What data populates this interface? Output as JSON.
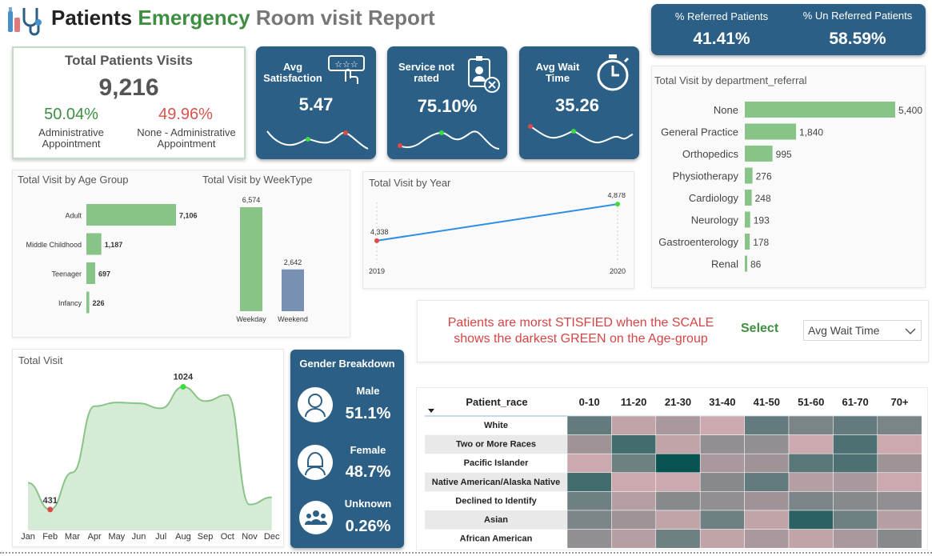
{
  "header": {
    "title_word1": "Patients",
    "title_word2": "Emergency",
    "title_word3": "Room visit Report",
    "logo_icon": "stethoscope-icon"
  },
  "referral_kpi": {
    "referred_label": "% Referred Patients",
    "referred_value": "41.41%",
    "unreferred_label": "% Un Referred Patients",
    "unreferred_value": "58.59%"
  },
  "total_visits_card": {
    "title": "Total Patients Visits",
    "value": "9,216",
    "admin_pct": "50.04%",
    "admin_label": "Administrative Appointment",
    "non_admin_pct": "49.96%",
    "non_admin_label": "None - Administrative Appointment",
    "colors": {
      "admin": "#3e8e41",
      "non_admin": "#d9534f"
    }
  },
  "kpis": [
    {
      "label": "Avg Satisfaction",
      "value": "5.47",
      "icon": "rating-stars-icon"
    },
    {
      "label": "Service not rated",
      "value": "75.10%",
      "icon": "id-badge-x-icon"
    },
    {
      "label": "Avg Wait Time",
      "value": "35.26",
      "icon": "stopwatch-icon"
    }
  ],
  "department_referral": {
    "title": "Total Visit by department_referral",
    "chart_data": {
      "type": "bar",
      "orientation": "horizontal",
      "categories": [
        "None",
        "General Practice",
        "Orthopedics",
        "Physiotherapy",
        "Cardiology",
        "Neurology",
        "Gastroenterology",
        "Renal"
      ],
      "values": [
        5400,
        1840,
        995,
        276,
        248,
        193,
        178,
        86
      ],
      "labels": [
        "5,400",
        "1,840",
        "995",
        "276",
        "248",
        "193",
        "178",
        "86"
      ],
      "color": "#88c488"
    }
  },
  "age_group": {
    "title": "Total Visit by Age Group",
    "chart_data": {
      "type": "bar",
      "orientation": "horizontal",
      "categories": [
        "Adult",
        "Middle Childhood",
        "Teenager",
        "Infancy"
      ],
      "values": [
        7106,
        1187,
        697,
        226
      ],
      "labels": [
        "7,106",
        "1,187",
        "697",
        "226"
      ],
      "color": "#88c488"
    }
  },
  "week_type": {
    "title": "Total Visit by WeekType",
    "chart_data": {
      "type": "bar",
      "categories": [
        "Weekday",
        "Weekend"
      ],
      "values": [
        6574,
        2642
      ],
      "labels": [
        "6,574",
        "2,642"
      ],
      "colors": [
        "#88c488",
        "#7891b3"
      ]
    }
  },
  "by_year": {
    "title": "Total Visit by Year",
    "chart_data": {
      "type": "line",
      "x": [
        "2019",
        "2020"
      ],
      "values": [
        4338,
        4878
      ],
      "labels": [
        "4,338",
        "4,878"
      ],
      "color": "#2f8de4"
    }
  },
  "insight": {
    "message_line1": "Patients are morst STISFIED when the SCALE",
    "message_line2": "shows the darkest GREEN on the Age-group",
    "select_label": "Select",
    "dropdown_value": "Avg Wait Time"
  },
  "total_visit": {
    "title": "Total Visit",
    "chart_data": {
      "type": "area",
      "x": [
        "Jan",
        "Feb",
        "Mar",
        "Apr",
        "May",
        "Jun",
        "Jul",
        "Aug",
        "Sep",
        "Oct",
        "Nov",
        "Dec"
      ],
      "values": [
        560,
        431,
        610,
        930,
        948,
        944,
        920,
        1024,
        955,
        985,
        455,
        490
      ],
      "annotations": [
        {
          "x": "Feb",
          "label": "431"
        },
        {
          "x": "Aug",
          "label": "1024"
        }
      ],
      "color": "#88c488"
    }
  },
  "gender": {
    "title": "Gender Breakdown",
    "items": [
      {
        "label": "Male",
        "value": "51.1%",
        "icon": "male-avatar-icon"
      },
      {
        "label": "Female",
        "value": "48.7%",
        "icon": "female-avatar-icon"
      },
      {
        "label": "Unknown",
        "value": "0.26%",
        "icon": "group-icon"
      }
    ]
  },
  "heatmap": {
    "chart_data": {
      "type": "heatmap",
      "row_header": "Patient_race",
      "columns": [
        "0-10",
        "11-20",
        "21-30",
        "31-40",
        "41-50",
        "51-60",
        "61-70",
        "70+"
      ],
      "rows": [
        "White",
        "Two or More Races",
        "Pacific Islander",
        "Native American/Alaska Native",
        "Declined to Identify",
        "Asian",
        "African American"
      ],
      "values": [
        [
          0.6,
          0.2,
          0.3,
          0.15,
          0.6,
          0.5,
          0.6,
          0.5
        ],
        [
          0.35,
          0.75,
          0.2,
          0.4,
          0.4,
          0.15,
          0.7,
          0.15
        ],
        [
          0.15,
          0.55,
          1.0,
          0.3,
          0.35,
          0.65,
          0.7,
          0.35
        ],
        [
          0.75,
          0.15,
          0.15,
          0.45,
          0.6,
          0.25,
          0.3,
          0.15
        ],
        [
          0.55,
          0.25,
          0.45,
          0.4,
          0.35,
          0.5,
          0.45,
          0.4
        ],
        [
          0.5,
          0.35,
          0.2,
          0.55,
          0.2,
          0.85,
          0.55,
          0.25
        ],
        [
          0.4,
          0.25,
          0.55,
          0.2,
          0.3,
          0.2,
          0.3,
          0.45
        ]
      ]
    }
  }
}
